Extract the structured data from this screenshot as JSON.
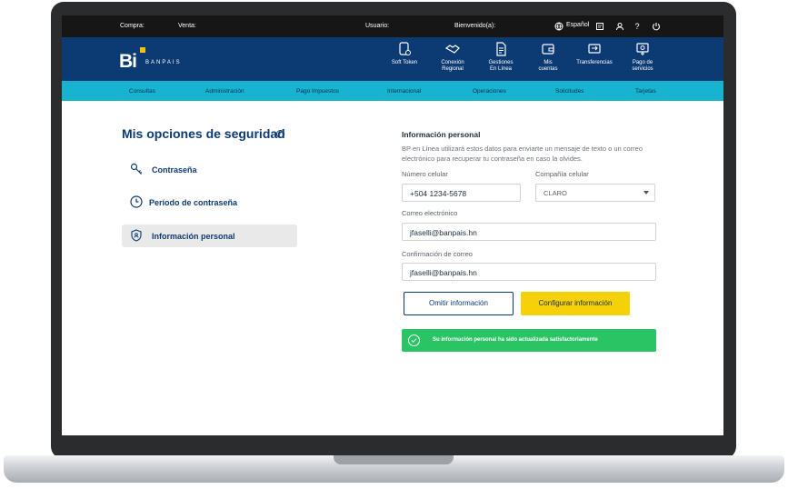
{
  "topbar": {
    "compra": "Compra:",
    "venta": "Venta:",
    "usuario": "Usuario:",
    "bienvenido": "Bienvenido(a):",
    "language": "Español"
  },
  "brand": {
    "logo": "Bi",
    "name": "BANPAIS",
    "accent": "#f0c20e",
    "primary": "#0c3a73"
  },
  "nav": {
    "soft_token": "Soft Token",
    "conexion_1": "Conexión",
    "conexion_2": "Regional",
    "gestiones_1": "Gestiones",
    "gestiones_2": "En Línea",
    "mis_1": "Mis",
    "mis_2": "cuentas",
    "transferencias": "Transferencias",
    "pago_1": "Pago de",
    "pago_2": "servicios"
  },
  "subnav": [
    "Consultas",
    "Administración",
    "Pago Impuestos",
    "Internacional",
    "Operaciones",
    "Solicitudes",
    "Tarjetas"
  ],
  "security": {
    "title": "Mis opciones de seguridad",
    "help": "?",
    "items": [
      {
        "label": "Contraseña",
        "icon": "key-icon"
      },
      {
        "label": "Período de contraseña",
        "icon": "clock-icon"
      },
      {
        "label": "Información personal",
        "icon": "shield-user-icon"
      }
    ]
  },
  "personal": {
    "title": "Información personal",
    "description": "BP en Línea utilizará estos datos para enviarte un mensaje de texto o un correo electrónico para recuperar tu contraseña en caso la olvides.",
    "phone_label": "Número celular",
    "phone_value": "+504  1234-5678",
    "company_label": "Compañía celular",
    "company_value": "CLARO",
    "email_label": "Correo electrónico",
    "email_value": "jfaselli@banpais.hn",
    "confirm_label": "Confirmación de correo",
    "confirm_value": "jfaselli@banpais.hn",
    "skip_button": "Omitir información",
    "configure_button": "Configurar información",
    "success_message": "Su información personal ha sido actualizada satisfactoriamente"
  }
}
